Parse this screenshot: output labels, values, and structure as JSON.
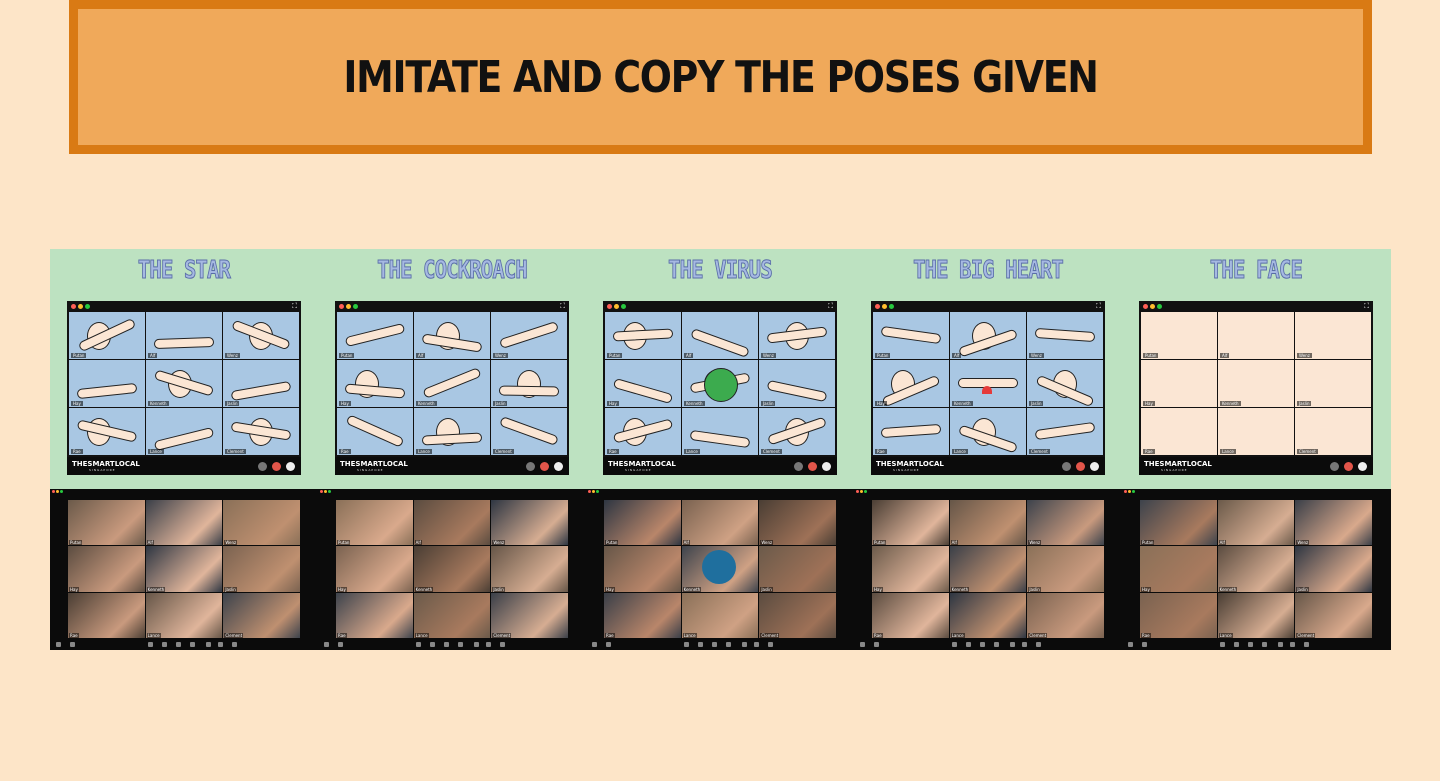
{
  "banner": {
    "title": "IMITATE AND COPY THE POSES GIVEN"
  },
  "colors": {
    "page_bg": "#fde5c8",
    "banner_border": "#d97a14",
    "banner_fill": "#f0a95a",
    "cartoon_bg": "#bde2c1",
    "title_fill": "#a6b9e2",
    "cell_bg": "#a9c7e3"
  },
  "panels": [
    {
      "title": "THE STAR"
    },
    {
      "title": "THE COCKROACH"
    },
    {
      "title": "THE VIRUS"
    },
    {
      "title": "THE BIG HEART"
    },
    {
      "title": "THE FACE"
    }
  ],
  "participants": [
    "Putan",
    "Alf",
    "Wenz",
    "Hay",
    "Kenneth",
    "Jaslin",
    "Rae",
    "Lance",
    "Clement"
  ],
  "brand": {
    "name": "THESMARTLOCAL",
    "sub": "SINGAPORE"
  },
  "icons": [
    "close-dot-icon",
    "minimize-dot-icon",
    "maximize-dot-icon",
    "fullscreen-icon",
    "mic-icon",
    "end-call-icon",
    "camera-icon"
  ]
}
